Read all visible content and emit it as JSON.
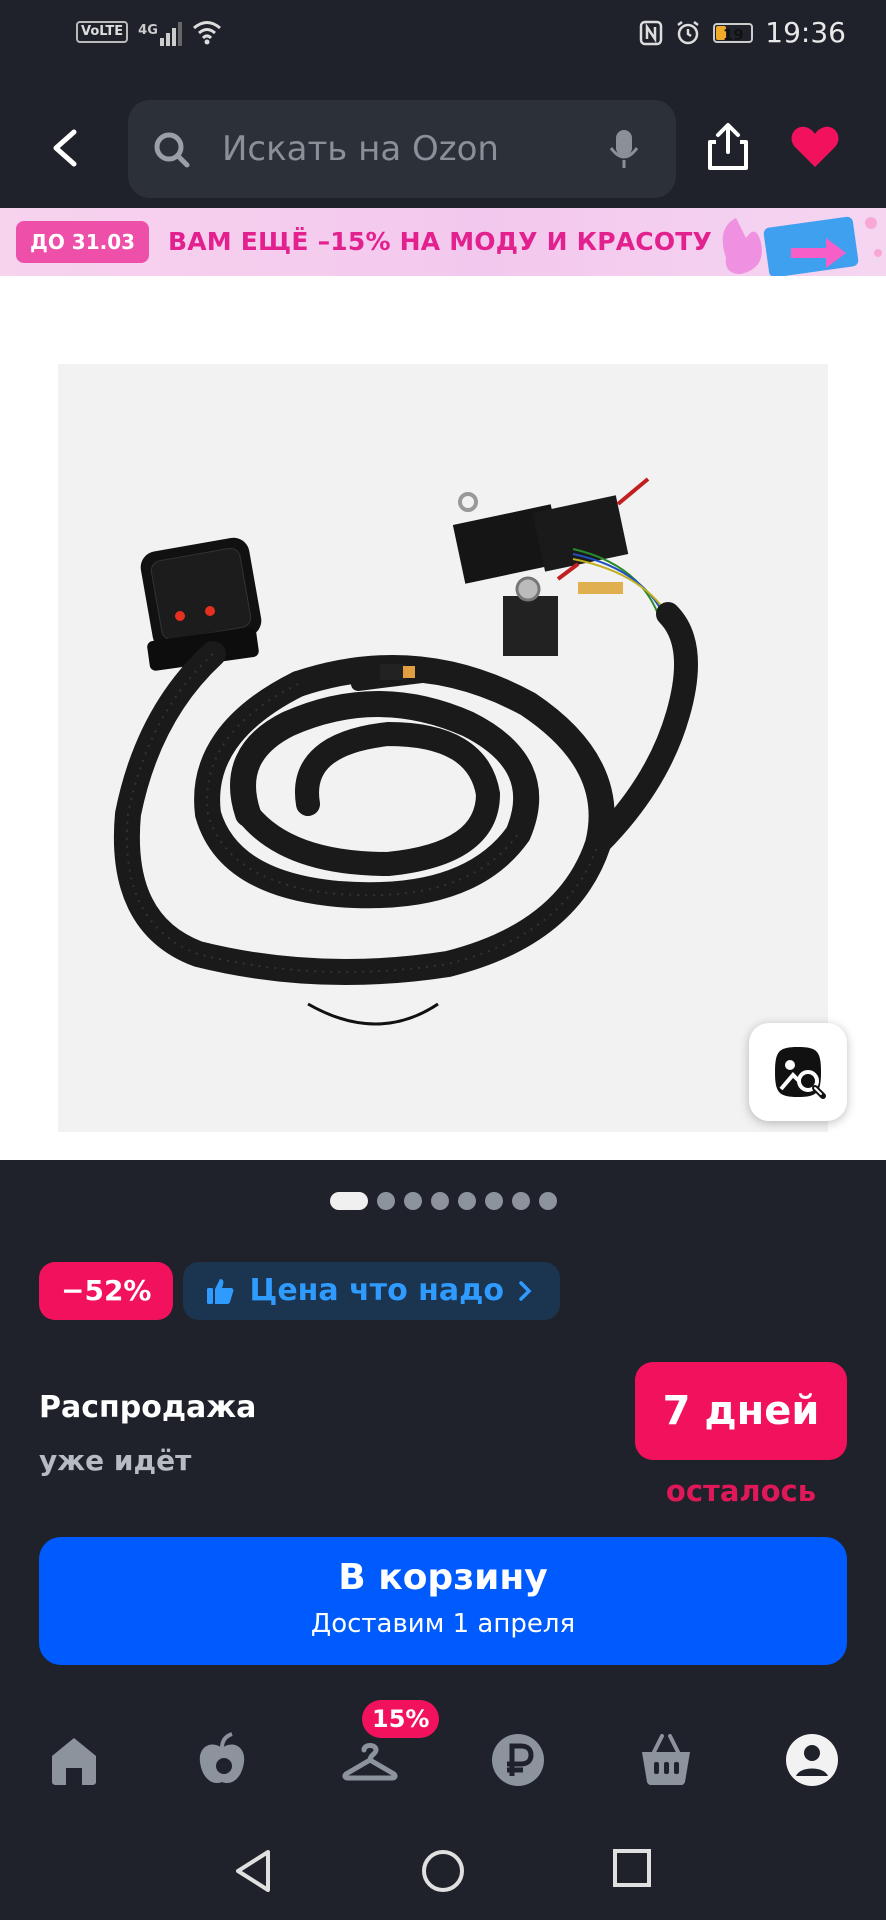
{
  "status_bar": {
    "network": "VoLTE",
    "signal": "4G",
    "battery": "19",
    "time": "19:36"
  },
  "header": {
    "search_placeholder": "Искать на Ozon",
    "icons": [
      "back-icon",
      "search-icon",
      "mic-icon",
      "share-icon",
      "heart-icon"
    ],
    "favorite_color": "#f1115d"
  },
  "promo_banner": {
    "date_badge": "ДО 31.03",
    "text": "ВАМ ЕЩЁ –15% НА МОДУ И КРАСОТУ"
  },
  "gallery": {
    "image_count": 8,
    "active_index": 0
  },
  "badges": {
    "discount": "−52%",
    "price_label": "Цена что надо"
  },
  "sale": {
    "title": "Распродажа",
    "subtitle": "уже идёт",
    "days": "7 дней",
    "remaining": "осталось"
  },
  "cart_button": {
    "label": "В корзину",
    "delivery": "Доставим 1 апреля",
    "color": "#005bff"
  },
  "tab_bar": {
    "items": [
      "home-icon",
      "fresh-icon",
      "fashion-icon",
      "finance-icon",
      "cart-icon",
      "profile-icon"
    ],
    "fashion_badge": "15%"
  },
  "nav_bar": [
    "back-nav-icon",
    "home-nav-icon",
    "recents-nav-icon"
  ]
}
